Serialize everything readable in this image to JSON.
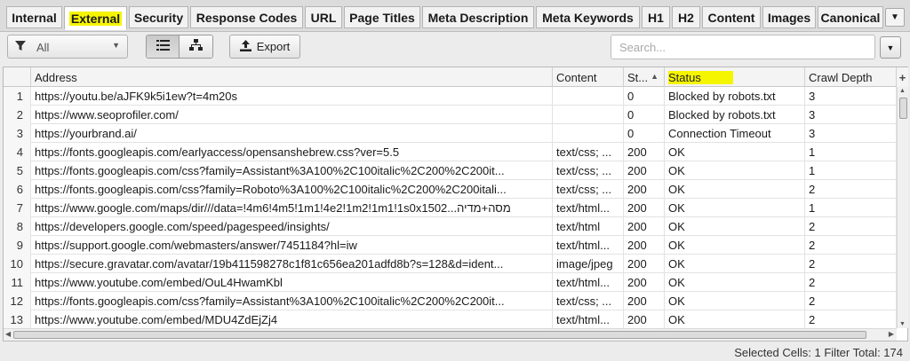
{
  "tabs": [
    {
      "label": "Internal",
      "active": false
    },
    {
      "label": "External",
      "active": true
    },
    {
      "label": "Security",
      "active": false
    },
    {
      "label": "Response Codes",
      "active": false
    },
    {
      "label": "URL",
      "active": false
    },
    {
      "label": "Page Titles",
      "active": false
    },
    {
      "label": "Meta Description",
      "active": false
    },
    {
      "label": "Meta Keywords",
      "active": false
    },
    {
      "label": "H1",
      "active": false
    },
    {
      "label": "H2",
      "active": false
    },
    {
      "label": "Content",
      "active": false
    },
    {
      "label": "Images",
      "active": false
    },
    {
      "label": "Canonical",
      "active": false
    }
  ],
  "toolbar": {
    "filter_value": "All",
    "filter_icon": "funnel-icon",
    "export_label": "Export",
    "search_placeholder": "Search..."
  },
  "grid": {
    "columns": [
      "",
      "Address",
      "Content",
      "St...",
      "Status",
      "Crawl Depth"
    ],
    "sorted_column": "St...",
    "highlighted_column": "Status",
    "rows": [
      {
        "n": "1",
        "address": "https://youtu.be/aJFK9k5i1ew?t=4m20s",
        "content": "",
        "code": "0",
        "status": "Blocked by robots.txt",
        "depth": "3"
      },
      {
        "n": "2",
        "address": "https://www.seoprofiler.com/",
        "content": "",
        "code": "0",
        "status": "Blocked by robots.txt",
        "depth": "3"
      },
      {
        "n": "3",
        "address": "https://yourbrand.ai/",
        "content": "",
        "code": "0",
        "status": "Connection Timeout",
        "depth": "3"
      },
      {
        "n": "4",
        "address": "https://fonts.googleapis.com/earlyaccess/opensanshebrew.css?ver=5.5",
        "content": "text/css; ...",
        "code": "200",
        "status": "OK",
        "depth": "1"
      },
      {
        "n": "5",
        "address": "https://fonts.googleapis.com/css?family=Assistant%3A100%2C100italic%2C200%2C200it...",
        "content": "text/css; ...",
        "code": "200",
        "status": "OK",
        "depth": "1"
      },
      {
        "n": "6",
        "address": "https://fonts.googleapis.com/css?family=Roboto%3A100%2C100italic%2C200%2C200itali...",
        "content": "text/css; ...",
        "code": "200",
        "status": "OK",
        "depth": "2"
      },
      {
        "n": "7",
        "address": "https://www.google.com/maps/dir///data=!4m6!4m5!1m1!4e2!1m2!1m1!1s0x1502...מסה+מדיה",
        "content": "text/html...",
        "code": "200",
        "status": "OK",
        "depth": "1"
      },
      {
        "n": "8",
        "address": "https://developers.google.com/speed/pagespeed/insights/",
        "content": "text/html",
        "code": "200",
        "status": "OK",
        "depth": "2"
      },
      {
        "n": "9",
        "address": "https://support.google.com/webmasters/answer/7451184?hl=iw",
        "content": "text/html...",
        "code": "200",
        "status": "OK",
        "depth": "2"
      },
      {
        "n": "10",
        "address": "https://secure.gravatar.com/avatar/19b411598278c1f81c656ea201adfd8b?s=128&d=ident...",
        "content": "image/jpeg",
        "code": "200",
        "status": "OK",
        "depth": "2"
      },
      {
        "n": "11",
        "address": "https://www.youtube.com/embed/OuL4HwamKbl",
        "content": "text/html...",
        "code": "200",
        "status": "OK",
        "depth": "2"
      },
      {
        "n": "12",
        "address": "https://fonts.googleapis.com/css?family=Assistant%3A100%2C100italic%2C200%2C200it...",
        "content": "text/css; ...",
        "code": "200",
        "status": "OK",
        "depth": "2"
      },
      {
        "n": "13",
        "address": "https://www.youtube.com/embed/MDU4ZdEjZj4",
        "content": "text/html...",
        "code": "200",
        "status": "OK",
        "depth": "2"
      }
    ]
  },
  "statusbar": {
    "text": "Selected Cells:  1  Filter Total:  174"
  },
  "colors": {
    "highlight": "#f6f500",
    "tab_bg": "#f2f2f2",
    "grid_bg": "#ffffff"
  }
}
